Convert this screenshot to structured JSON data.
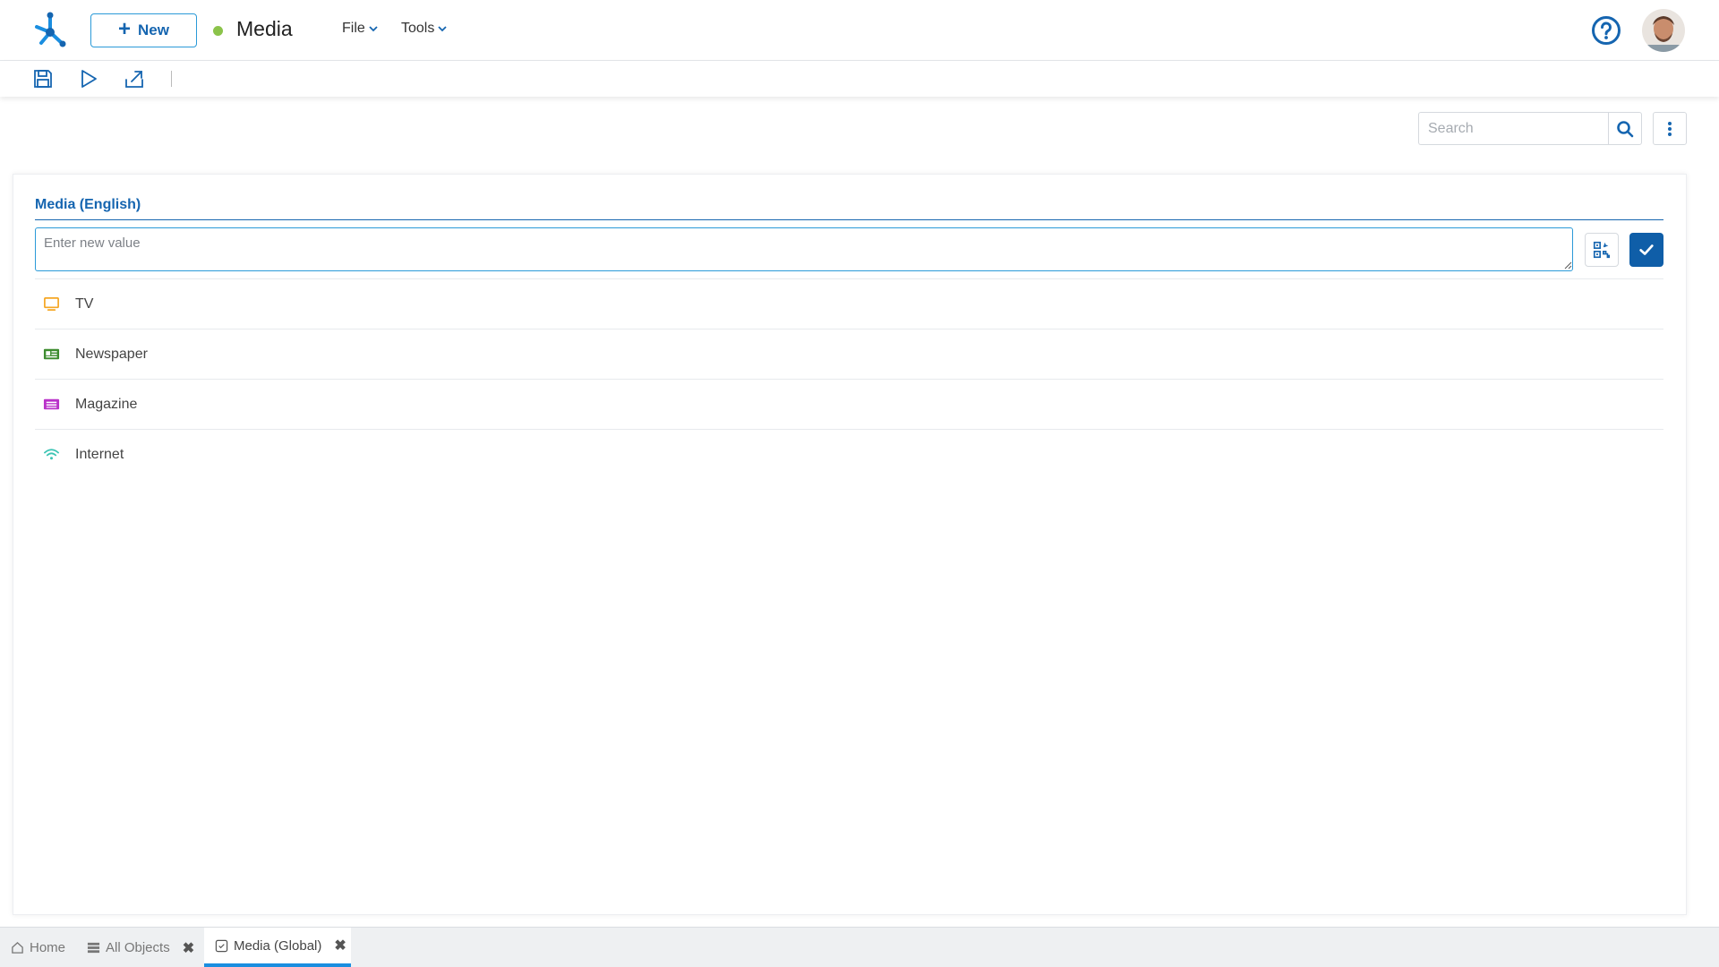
{
  "header": {
    "new_label": "New",
    "title": "Media",
    "status_color": "#8bc34a",
    "menus": [
      {
        "label": "File"
      },
      {
        "label": "Tools"
      }
    ],
    "help_icon": "question-circle-icon",
    "avatar": "user-avatar"
  },
  "toolbar": {
    "icons": [
      "save-icon",
      "run-icon",
      "export-icon"
    ]
  },
  "search": {
    "placeholder": "Search"
  },
  "panel": {
    "section_title": "Media (English)",
    "input_placeholder": "Enter new value",
    "items": [
      {
        "label": "TV",
        "icon": "tv-icon",
        "color": "#f5a623"
      },
      {
        "label": "Newspaper",
        "icon": "newspaper-icon",
        "color": "#3d8c2f"
      },
      {
        "label": "Magazine",
        "icon": "magazine-icon",
        "color": "#b931c9"
      },
      {
        "label": "Internet",
        "icon": "wifi-icon",
        "color": "#3cc4b4"
      }
    ]
  },
  "tabs": [
    {
      "label": "Home",
      "icon": "home-icon",
      "closable": false
    },
    {
      "label": "All Objects",
      "icon": "table-icon",
      "closable": true
    },
    {
      "label": "Media (Global)",
      "icon": "checkbox-icon",
      "closable": true,
      "active": true
    }
  ],
  "colors": {
    "accent": "#1565b0",
    "accent_light": "#2b9ad8",
    "confirm": "#0f5ea8"
  }
}
